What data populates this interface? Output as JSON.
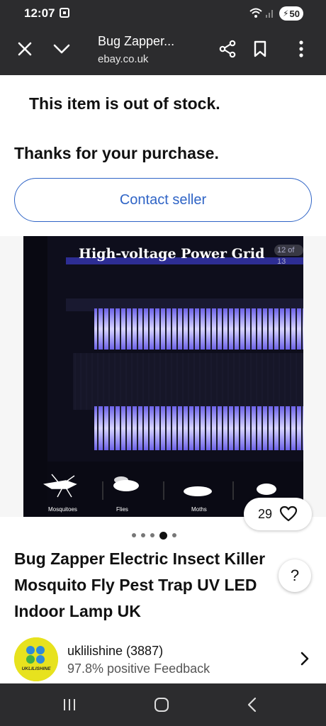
{
  "status_bar": {
    "time": "12:07",
    "battery": "50",
    "icons": [
      "screen-record-icon",
      "wifi-icon",
      "signal-icon",
      "battery-charging-icon"
    ]
  },
  "browser": {
    "page_title": "Bug Zapper...",
    "domain": "ebay.co.uk",
    "icons": [
      "close-icon",
      "chevron-down-icon",
      "share-icon",
      "bookmark-icon",
      "more-vertical-icon"
    ]
  },
  "listing": {
    "out_of_stock": "This item is out of stock.",
    "thanks": "Thanks for your purchase.",
    "contact_label": "Contact seller",
    "image": {
      "caption": "High-voltage Power Grid",
      "counter": "12 of 13",
      "insects": [
        "Mosquitoes",
        "Flies",
        "Moths"
      ]
    },
    "watch_count": "29",
    "dots_total": 5,
    "dots_active": 3,
    "title_lines": [
      "Bug Zapper Electric Insect Killer",
      "Mosquito Fly Pest Trap UV LED",
      "Indoor Lamp UK"
    ],
    "help_label": "?"
  },
  "seller": {
    "name": "uklilishine (3887)",
    "feedback": "97.8% positive Feedback",
    "logo_text": "UKLILISHINE"
  },
  "nav_icons": [
    "recent-apps-icon",
    "home-icon",
    "back-icon"
  ],
  "colors": {
    "accent": "#2f64c6",
    "toolbar": "#2c2c2e",
    "uv_glow": "#b9b6ff",
    "avatar": "#e7e21e"
  }
}
